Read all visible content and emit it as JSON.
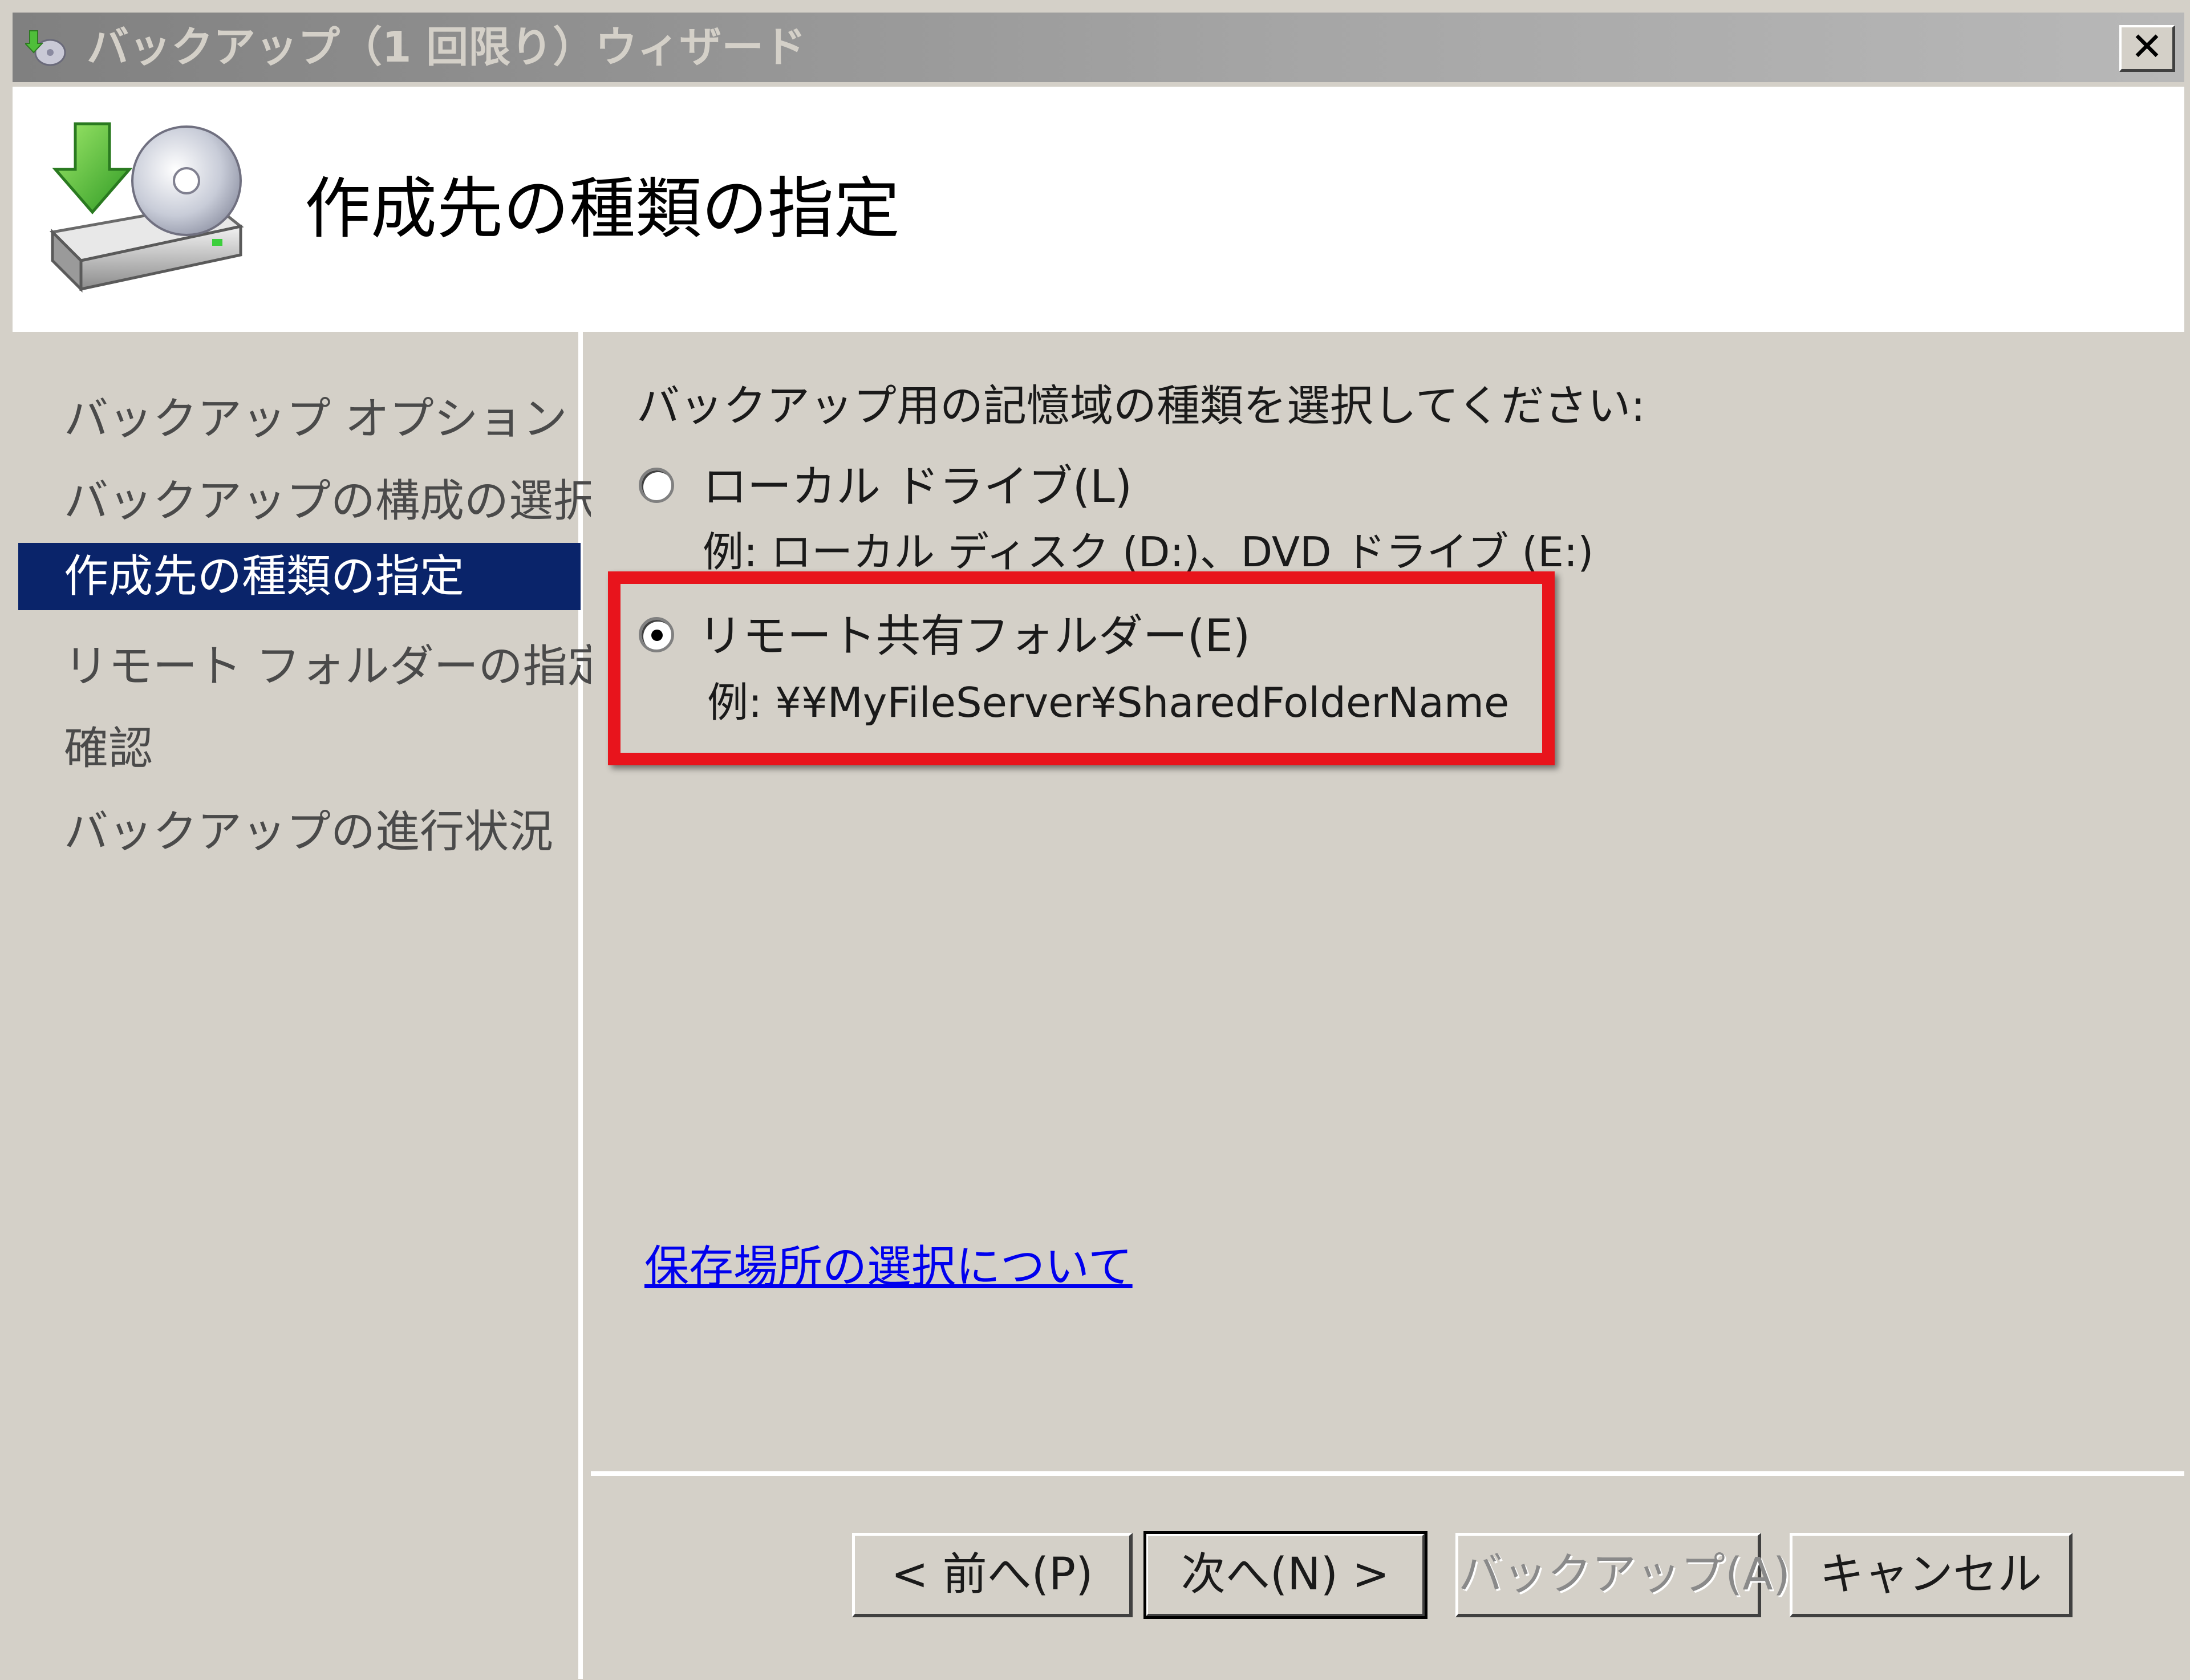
{
  "window": {
    "title": "バックアップ（1 回限り）ウィザード",
    "close_label": "✕"
  },
  "header": {
    "title": "作成先の種類の指定",
    "icon": "backup-drive-icon"
  },
  "nav": {
    "items": [
      {
        "label": "バックアップ オプション",
        "active": false
      },
      {
        "label": "バックアップの構成の選択",
        "active": false
      },
      {
        "label": "作成先の種類の指定",
        "active": true
      },
      {
        "label": "リモート フォルダーの指定",
        "active": false
      },
      {
        "label": "確認",
        "active": false
      },
      {
        "label": "バックアップの進行状況",
        "active": false
      }
    ]
  },
  "main": {
    "prompt": "バックアップ用の記憶域の種類を選択してください:",
    "options": [
      {
        "label": "ローカル ドライブ(L)",
        "example": "例: ローカル ディスク (D:)、DVD ドライブ (E:)",
        "selected": false
      },
      {
        "label": "リモート共有フォルダー(E)",
        "example": "例: ¥¥MyFileServer¥SharedFolderName",
        "selected": true
      }
    ],
    "help_link": "保存場所の選択について"
  },
  "footer": {
    "back_label": "< 前へ(P)",
    "next_label": "次へ(N) >",
    "backup_label": "バックアップ(A)",
    "cancel_label": "キャンセル"
  },
  "colors": {
    "highlight": "#e8141c",
    "nav_active_bg": "#0a246a",
    "link": "#0000ee"
  }
}
